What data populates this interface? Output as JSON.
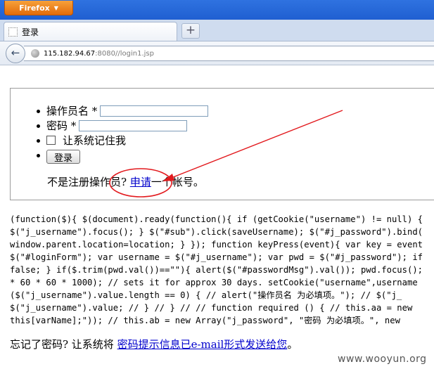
{
  "browser": {
    "menu_button_label": "Firefox",
    "tab_title": "登录",
    "newtab_label": "+",
    "url_host": "115.182.94.67",
    "url_rest": ":8080//login1.jsp"
  },
  "form": {
    "username_label": "操作员名 *",
    "password_label": "密码 *",
    "remember_label": "让系统记住我",
    "login_button": "登录",
    "register_prefix": "不是注册操作员? ",
    "register_link": "申请",
    "register_suffix": "一个帐号。"
  },
  "script_source": {
    "lines": [
      "(function($){ $(document).ready(function(){ if (getCookie(\"username\") != null) {",
      "$(\"j_username\").focus(); } $(\"#sub\").click(saveUsername); $(\"#j_password\").bind(",
      "window.parent.location=location; } }); function keyPress(event){ var key = event",
      "$(\"#loginForm\"); var username = $(\"#j_username\"); var pwd = $(\"#j_password\"); if",
      "false; } if($.trim(pwd.val())==\"\"){ alert($(\"#passwordMsg\").val()); pwd.focus();",
      "* 60 * 60 * 1000); // sets it for approx 30 days. setCookie(\"username\",username",
      "($(\"j_username\").value.length == 0) { // alert(\"操作员名 为必填项。\"); // $(\"j_",
      "$(\"j_username\").value; // } // } // // function required () { // this.aa = new",
      "this[varName];\")); // this.ab = new Array(\"j_password\", \"密码 为必填项。\", new"
    ]
  },
  "forgot": {
    "prefix": "忘记了密码? 让系统将 ",
    "link": "密码提示信息已e-mail形式发送给您",
    "suffix": "。"
  },
  "watermark": "www.wooyun.org",
  "colors": {
    "link": "#0000cc",
    "annotation": "#e2191d",
    "firefox_orange": "#e26b0a"
  }
}
